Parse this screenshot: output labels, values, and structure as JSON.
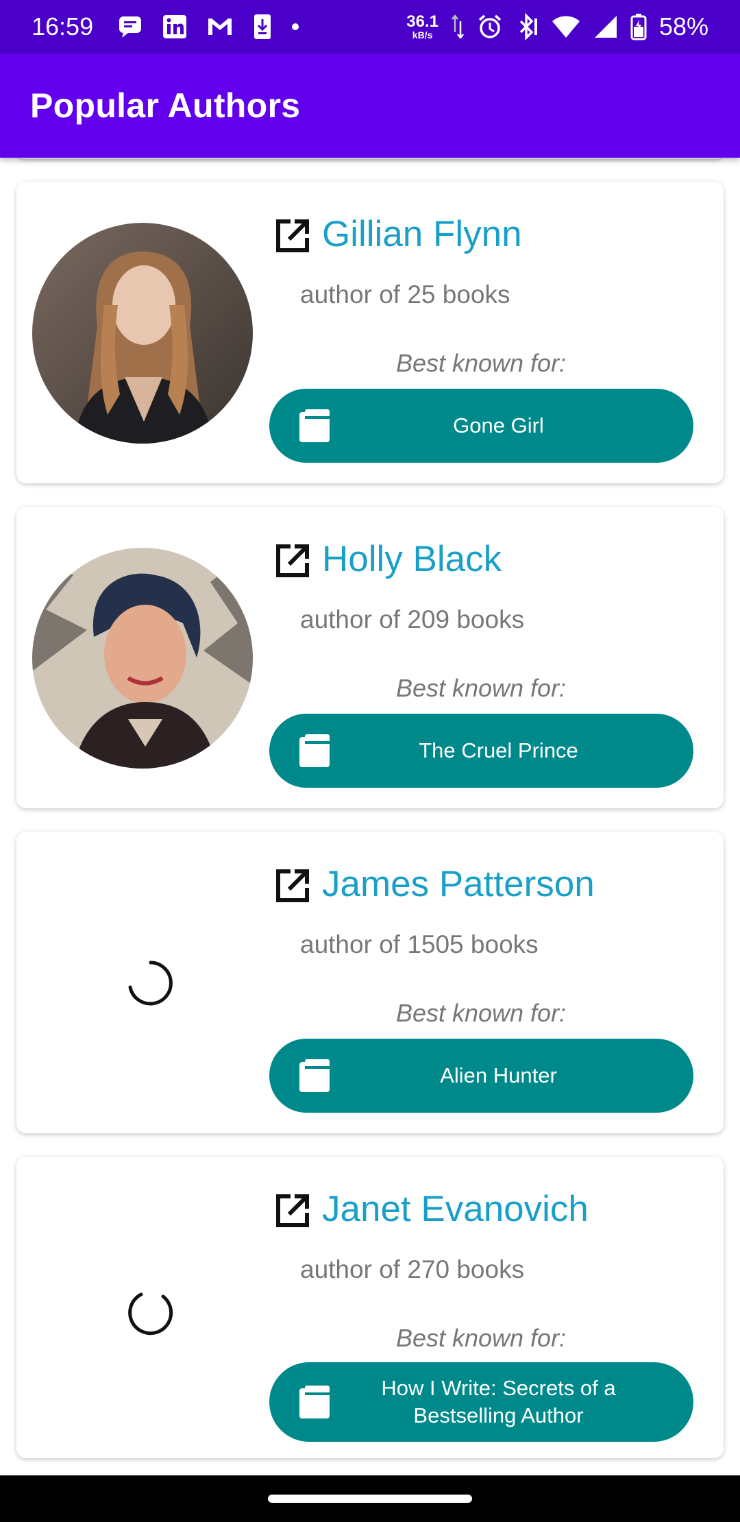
{
  "status_bar": {
    "time": "16:59",
    "net_speed_value": "36.1",
    "net_speed_unit": "kB/s",
    "battery": "58%",
    "icons": [
      "messages-icon",
      "linkedin-icon",
      "gmail-icon",
      "download-icon",
      "dot-icon",
      "data-arrows-icon",
      "alarm-icon",
      "bluetooth-icon",
      "wifi-icon",
      "signal-icon",
      "battery-icon"
    ]
  },
  "app_bar": {
    "title": "Popular Authors"
  },
  "authors": [
    {
      "name": "Gillian Flynn",
      "count": "author of 25 books",
      "known_label": "Best known for:",
      "book": "Gone Girl",
      "image_state": "loaded"
    },
    {
      "name": "Holly Black",
      "count": "author of 209 books",
      "known_label": "Best known for:",
      "book": "The Cruel Prince",
      "image_state": "loaded"
    },
    {
      "name": "James Patterson",
      "count": "author of 1505 books",
      "known_label": "Best known for:",
      "book": "Alien Hunter",
      "image_state": "loading"
    },
    {
      "name": "Janet Evanovich",
      "count": "author of 270 books",
      "known_label": "Best known for:",
      "book": "How I Write: Secrets of a Bestselling Author",
      "image_state": "loading"
    }
  ],
  "colors": {
    "status_bar": "#4a00c8",
    "app_bar": "#6200ee",
    "author_name": "#1aa0c8",
    "button": "#00898a"
  }
}
